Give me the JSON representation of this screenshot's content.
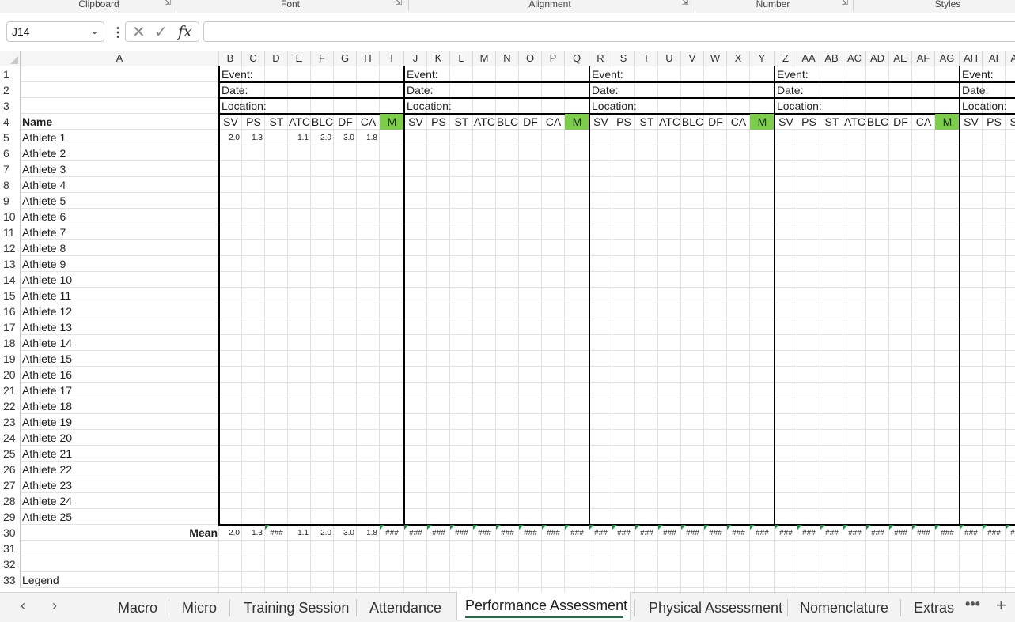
{
  "ribbon": {
    "groups": [
      {
        "name": "group-clipboard",
        "label": "Clipboard"
      },
      {
        "name": "group-font",
        "label": "Font"
      },
      {
        "name": "group-alignment",
        "label": "Alignment"
      },
      {
        "name": "group-number",
        "label": "Number"
      },
      {
        "name": "group-styles",
        "label": "Styles"
      }
    ],
    "launcher_icon": "dialog-launcher-icon"
  },
  "formula_bar": {
    "name_box": "J14",
    "formula": "",
    "icons": [
      "more-options-icon",
      "cancel-formula-icon",
      "confirm-formula-icon",
      "insert-function-icon"
    ]
  },
  "columns": [
    "A",
    "B",
    "C",
    "D",
    "E",
    "F",
    "G",
    "H",
    "I",
    "J",
    "K",
    "L",
    "M",
    "N",
    "O",
    "P",
    "Q",
    "R",
    "S",
    "T",
    "U",
    "V",
    "W",
    "X",
    "Y",
    "Z",
    "AA",
    "AB",
    "AC",
    "AD",
    "AE",
    "AF",
    "AG",
    "AH",
    "AI",
    "AJ"
  ],
  "row_numbers": [
    "1",
    "2",
    "3",
    "4",
    "5",
    "6",
    "7",
    "8",
    "9",
    "10",
    "11",
    "12",
    "13",
    "14",
    "15",
    "16",
    "17",
    "18",
    "19",
    "20",
    "21",
    "22",
    "23",
    "24",
    "25",
    "26",
    "27",
    "28",
    "29",
    "30",
    "31",
    "32",
    "33"
  ],
  "sheet": {
    "name_header": "Name",
    "athletes": [
      "Athlete 1",
      "Athlete 2",
      "Athlete 3",
      "Athlete 4",
      "Athlete 5",
      "Athlete 6",
      "Athlete 7",
      "Athlete 8",
      "Athlete 9",
      "Athlete 10",
      "Athlete 11",
      "Athlete 12",
      "Athlete 13",
      "Athlete 14",
      "Athlete 15",
      "Athlete 16",
      "Athlete 17",
      "Athlete 18",
      "Athlete 19",
      "Athlete 20",
      "Athlete 21",
      "Athlete 22",
      "Athlete 23",
      "Athlete 24",
      "Athlete 25"
    ],
    "mean_label": "Mean",
    "legend_label": "Legend",
    "block_labels": {
      "event": "Event:",
      "date": "Date:",
      "location": "Location:"
    },
    "sub_headers": [
      "SV",
      "PS",
      "ST",
      "ATC",
      "BLC",
      "DF",
      "CA",
      "M"
    ],
    "athlete1_values": [
      "2.0",
      "1.3",
      "",
      "1.1",
      "2.0",
      "3.0",
      "1.8",
      ""
    ],
    "mean_values_block1": [
      "2.0",
      "1.3",
      "###",
      "1.1",
      "2.0",
      "3.0",
      "1.8",
      "###"
    ],
    "overflow_marker": "###",
    "highlight_color": "#7ccd4a",
    "error_triangle_color": "#1e8f46"
  },
  "tabs": {
    "items": [
      "Macro",
      "Micro",
      "Training Session",
      "Attendance",
      "Performance Assessment",
      "Physical Assessment",
      "Nomenclature",
      "Extras"
    ],
    "active": "Performance Assessment",
    "prev_icon": "chevron-left-icon",
    "next_icon": "chevron-right-icon",
    "more_icon": "more-sheets-icon",
    "add_icon": "add-sheet-icon"
  }
}
